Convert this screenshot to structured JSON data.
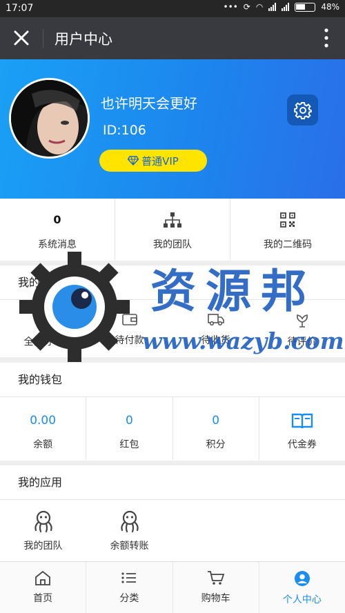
{
  "status_bar": {
    "time": "17:07",
    "battery": "48%"
  },
  "title_bar": {
    "title": "用户中心"
  },
  "profile": {
    "name": "也许明天会更好",
    "id": "ID:106",
    "vip_label": "普通VIP"
  },
  "stats": [
    {
      "value": "0",
      "label": "系统消息"
    },
    {
      "icon": "org-chart-icon",
      "label": "我的团队"
    },
    {
      "icon": "qrcode-icon",
      "label": "我的二维码"
    }
  ],
  "orders": {
    "title": "我的订单",
    "items": [
      {
        "icon": "document-icon",
        "label": "全部订单"
      },
      {
        "icon": "wallet-icon",
        "label": "待付款"
      },
      {
        "icon": "truck-icon",
        "label": "待收货"
      },
      {
        "icon": "flower-icon",
        "label": "待评价"
      }
    ]
  },
  "wallet": {
    "title": "我的钱包",
    "items": [
      {
        "value": "0.00",
        "label": "余额"
      },
      {
        "value": "0",
        "label": "红包"
      },
      {
        "value": "0",
        "label": "积分"
      },
      {
        "icon": "book-icon",
        "label": "代金券"
      }
    ]
  },
  "apps": {
    "title": "我的应用",
    "items": [
      {
        "icon": "octopus-icon",
        "label": "我的团队"
      },
      {
        "icon": "octopus-icon",
        "label": "余额转账"
      }
    ]
  },
  "tabbar": {
    "items": [
      {
        "icon": "home-icon",
        "label": "首页"
      },
      {
        "icon": "list-icon",
        "label": "分类"
      },
      {
        "icon": "cart-icon",
        "label": "购物车"
      },
      {
        "icon": "user-circle-icon",
        "label": "个人中心"
      }
    ],
    "active_index": 3
  },
  "watermark": {
    "text_cn": "资源邦",
    "text_url": "www.wazyb.com"
  },
  "colors": {
    "accent": "#1a8ef0",
    "header_dark": "#393a3f",
    "vip_yellow": "#ffe400",
    "hero_blue": "#1c86ee"
  }
}
